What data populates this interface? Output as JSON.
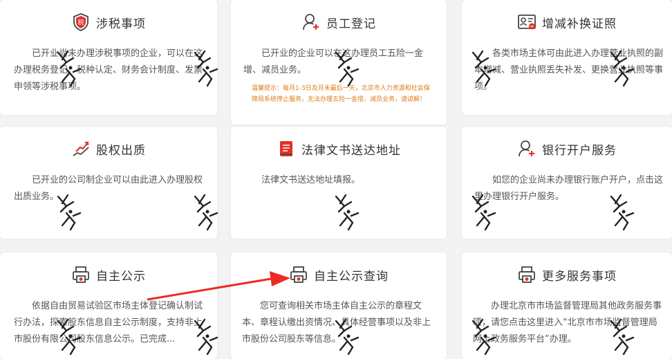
{
  "cards": [
    {
      "title": "涉税事项",
      "icon": "tax-shield-icon",
      "desc": "已开业尚未办理涉税事项的企业，可以在这办理税务登记、税种认定、财务会计制度、发票申领等涉税事项。"
    },
    {
      "title": "员工登记",
      "icon": "user-add-icon",
      "desc": "已开业的企业可以在这办理员工五险一金增、减员业务。",
      "note": "温馨提示：每月1-3日及月末最后一天，北京市人力资源和社会保障局系统停止服务，无法办理五险一金增、减员业务，请谅解！"
    },
    {
      "title": "增减补换证照",
      "icon": "license-certificate-icon",
      "desc": "各类市场主体可由此进入办理营业执照的副本增减、营业执照丢失补发、更换营业执照等事项。"
    },
    {
      "title": "股权出质",
      "icon": "equity-chart-icon",
      "desc": "已开业的公司制企业可以由此进入办理股权出质业务。"
    },
    {
      "title": "法律文书送达地址",
      "icon": "document-book-icon",
      "desc": "法律文书送达地址填报。"
    },
    {
      "title": "银行开户服务",
      "icon": "user-add-icon",
      "desc": "如您的企业尚未办理银行账户开户，点击这里办理银行开户服务。"
    },
    {
      "title": "自主公示",
      "icon": "printer-icon",
      "desc": "依据自由贸易试验区市场主体登记确认制试行办法，探索股东信息自主公示制度，支持非上市股份有限公司股东信息公示。已完成..."
    },
    {
      "title": "自主公示查询",
      "icon": "printer-icon",
      "desc": "您可查询相关市场主体自主公示的章程文本、章程认缴出资情况、具体经营事项以及非上市股份公司股东等信息。"
    },
    {
      "title": "更多服务事项",
      "icon": "printer-icon",
      "desc": "办理北京市市场监督管理局其他政务服务事项，请您点击这里进入“北京市市场监督管理局网上政务服务平台”办理。"
    }
  ],
  "colors": {
    "accent": "#e2332b",
    "title": "#333333",
    "text": "#555555",
    "note": "#e07a16",
    "background": "#f2f3f5"
  },
  "watermark_icon": "runner-seal-icon"
}
